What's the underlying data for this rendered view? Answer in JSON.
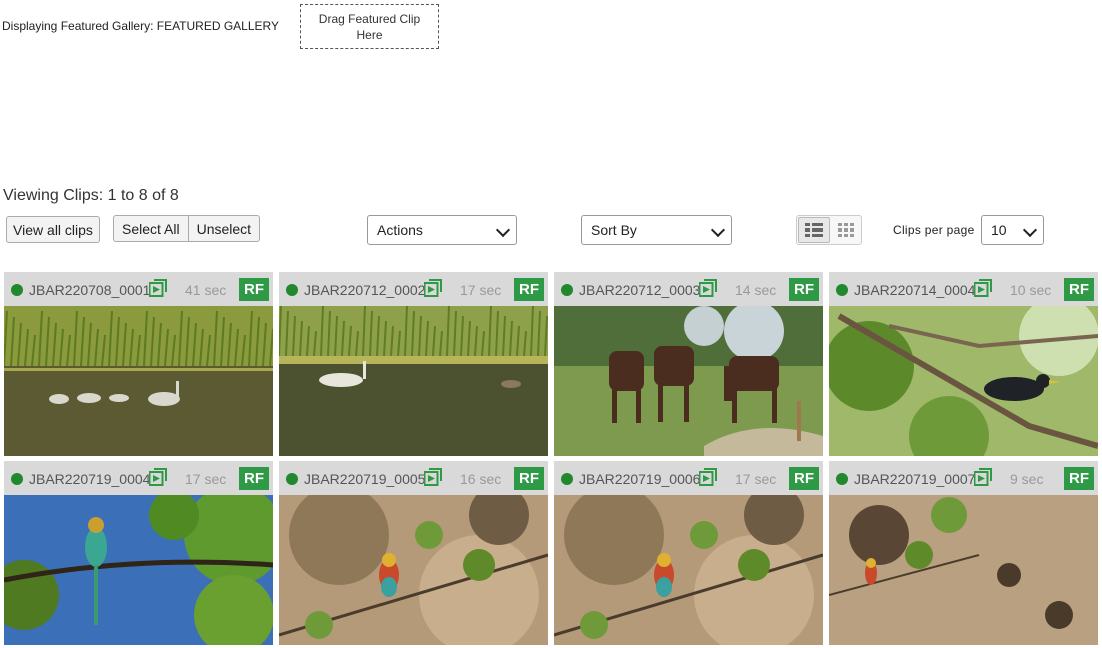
{
  "featured": {
    "label": "Displaying Featured Gallery: FEATURED GALLERY",
    "drop_zone": "Drag Featured Clip Here"
  },
  "viewing": "Viewing Clips: 1 to 8 of 8",
  "toolbar": {
    "view_all": "View all clips",
    "select_all": "Select All",
    "unselect": "Unselect",
    "actions": "Actions",
    "sort_by": "Sort By",
    "per_page_label": "Clips per page",
    "per_page_value": "10"
  },
  "clips": [
    {
      "id": "JBAR220708_0001",
      "duration": "41 sec",
      "license": "RF",
      "scene": "swans-reeds"
    },
    {
      "id": "JBAR220712_0002",
      "duration": "17 sec",
      "license": "RF",
      "scene": "swan-lake"
    },
    {
      "id": "JBAR220712_0003",
      "duration": "14 sec",
      "license": "RF",
      "scene": "horses-meadow"
    },
    {
      "id": "JBAR220714_0004",
      "duration": "10 sec",
      "license": "RF",
      "scene": "starling-branch"
    },
    {
      "id": "JBAR220719_0004",
      "duration": "17 sec",
      "license": "RF",
      "scene": "bee-eater-sky"
    },
    {
      "id": "JBAR220719_0005",
      "duration": "16 sec",
      "license": "RF",
      "scene": "bee-eater-cliff"
    },
    {
      "id": "JBAR220719_0006",
      "duration": "17 sec",
      "license": "RF",
      "scene": "bee-eater-cliff"
    },
    {
      "id": "JBAR220719_0007",
      "duration": "9 sec",
      "license": "RF",
      "scene": "bee-eater-cliff-far"
    }
  ],
  "colors": {
    "status_dot": "#22882d",
    "rf_badge": "#2e9a45",
    "header_bg": "#d9d9d9"
  }
}
